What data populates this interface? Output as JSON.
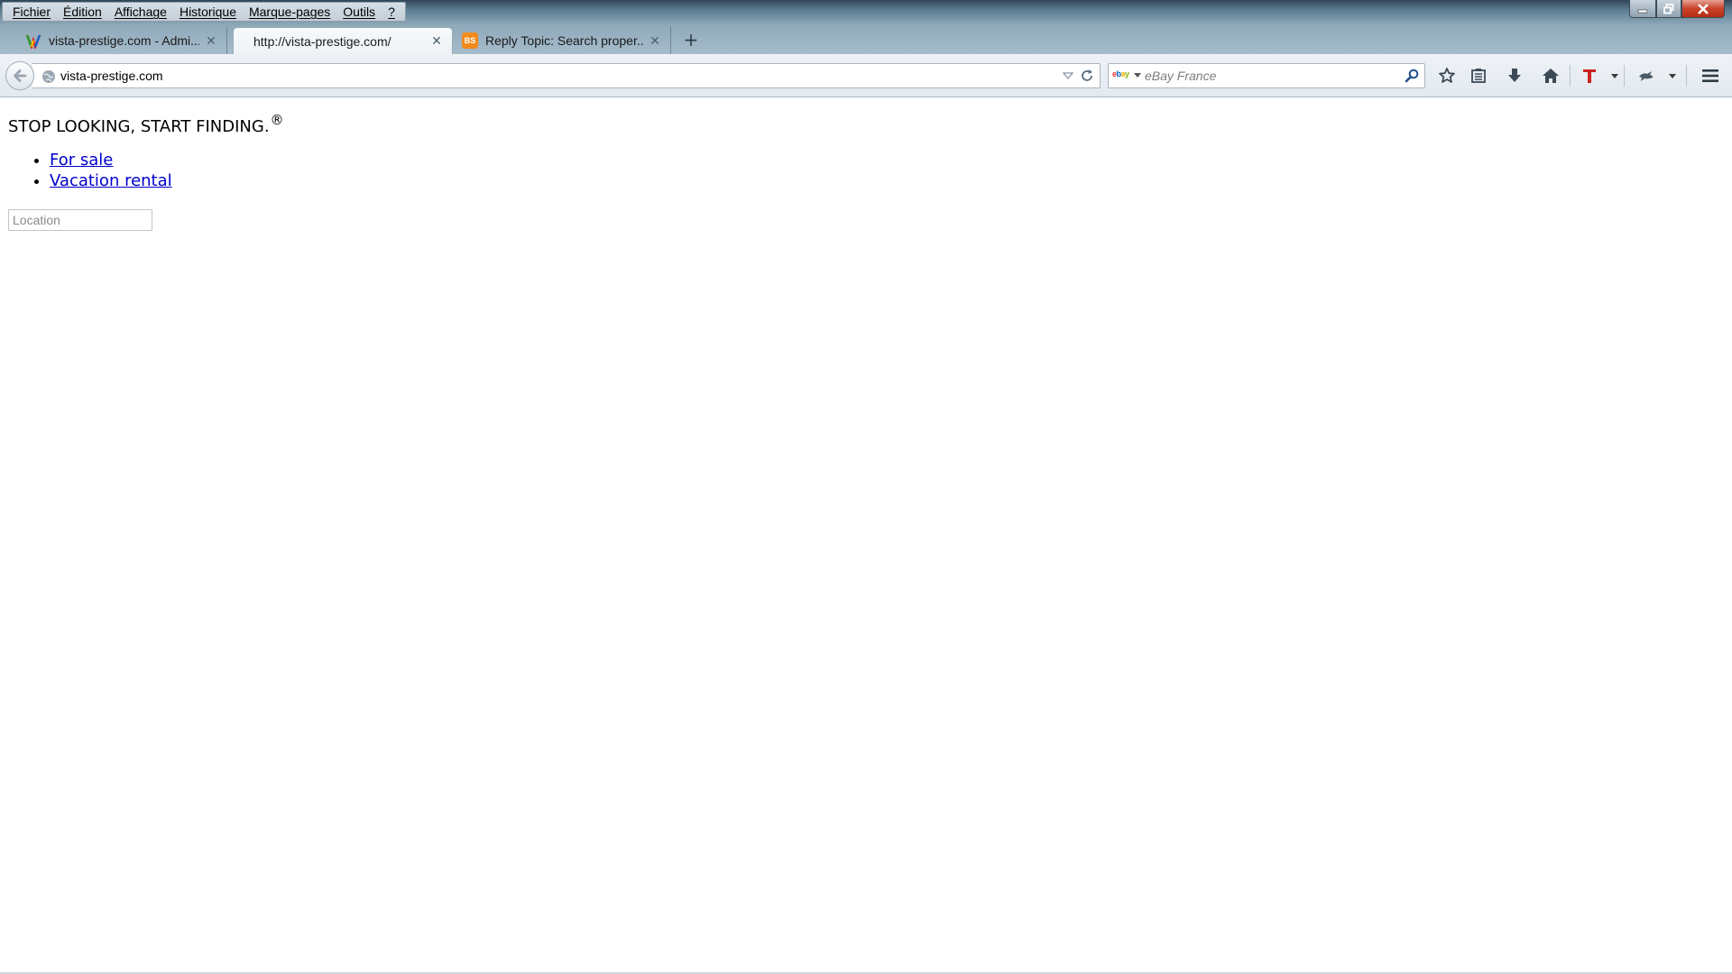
{
  "menubar": {
    "items": [
      "Fichier",
      "Édition",
      "Affichage",
      "Historique",
      "Marque-pages",
      "Outils",
      "?"
    ]
  },
  "tabs": [
    {
      "title": "vista-prestige.com - Admi...",
      "icon": "wordpress-multicolor-icon",
      "active": false
    },
    {
      "title": "http://vista-prestige.com/",
      "icon": "",
      "active": true
    },
    {
      "title": "Reply Topic: Search proper...",
      "icon": "bs-favicon-icon",
      "icon_text": "BS",
      "active": false
    }
  ],
  "newtab_label": "+",
  "navbar": {
    "url": "vista-prestige.com",
    "search_engine": "ebay",
    "search_engine_logo": [
      "e",
      "b",
      "a",
      "y"
    ],
    "search_placeholder": "eBay France"
  },
  "toolbar_icons": [
    "star-icon",
    "reading-list-icon",
    "download-icon",
    "home-icon",
    "t-addon-icon",
    "bird-addon-icon",
    "hamburger-menu-icon"
  ],
  "page": {
    "headline": "STOP LOOKING, START FINDING.",
    "registered": "®",
    "links": [
      "For sale",
      "Vacation rental"
    ],
    "location_placeholder": "Location"
  },
  "colors": {
    "link": "#0000cc",
    "addon_t": "#cc2222",
    "bs_favicon": "#f28a1e",
    "close_button": "#c7432a"
  }
}
